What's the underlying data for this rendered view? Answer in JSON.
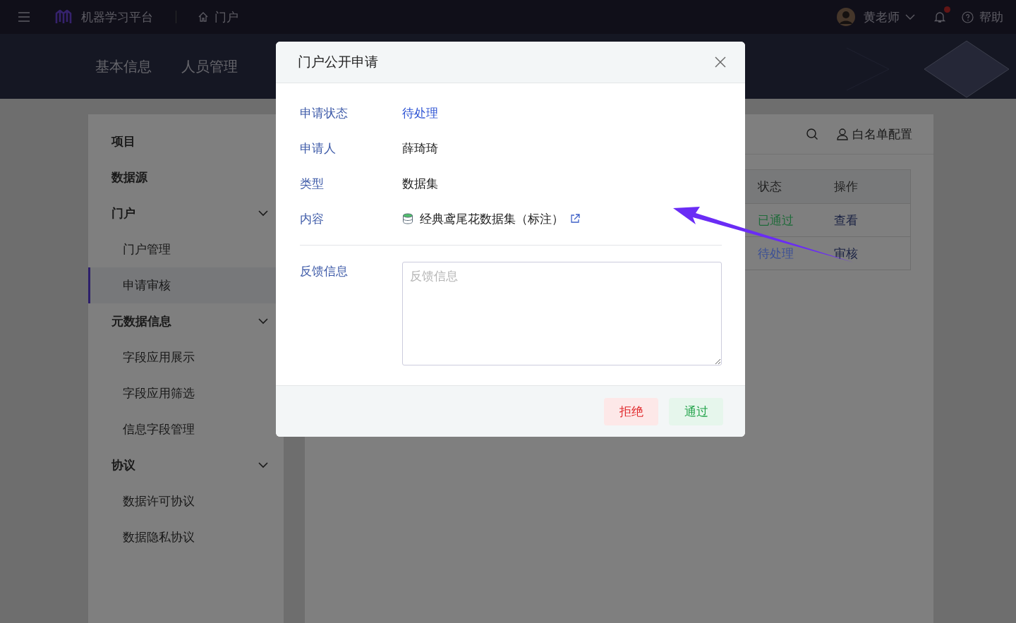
{
  "topbar": {
    "app_name": "机器学习平台",
    "breadcrumb": "门户",
    "user": "黄老师",
    "notification_dot": true,
    "help": "帮助"
  },
  "banner_tabs": [
    {
      "label": "基本信息",
      "selected": false
    },
    {
      "label": "人员管理",
      "selected": false
    }
  ],
  "sidebar": [
    {
      "label": "项目",
      "selected": false
    },
    {
      "label": "数据源",
      "selected": false
    },
    {
      "label": "门户",
      "expanded": true,
      "children": [
        {
          "label": "门户管理",
          "selected": false
        },
        {
          "label": "申请审核",
          "selected": true
        }
      ]
    },
    {
      "label": "元数据信息",
      "expanded": true,
      "children": [
        {
          "label": "字段应用展示",
          "selected": false
        },
        {
          "label": "字段应用筛选",
          "selected": false
        },
        {
          "label": "信息字段管理",
          "selected": false
        }
      ]
    },
    {
      "label": "协议",
      "expanded": true,
      "children": [
        {
          "label": "数据许可协议",
          "selected": false
        },
        {
          "label": "数据隐私协议",
          "selected": false
        }
      ]
    }
  ],
  "toolbar": {
    "whitelist": "白名单配置"
  },
  "table": {
    "columns": [
      "状态",
      "操作"
    ],
    "rows": [
      {
        "status": "已通过",
        "color": "#1f6b3a",
        "action": "查看"
      },
      {
        "status": "待处理",
        "color": "#3d5196",
        "action": "审核"
      }
    ]
  },
  "dialog": {
    "title": "门户公开申请",
    "fields": [
      {
        "kind": "status",
        "label": "申请状态",
        "value": "待处理"
      },
      {
        "kind": "text",
        "label": "申请人",
        "value": "薛琦琦"
      },
      {
        "kind": "text",
        "label": "类型",
        "value": "数据集"
      },
      {
        "kind": "link",
        "label": "内容",
        "value": "经典鸢尾花数据集（标注）"
      }
    ],
    "feedback": {
      "label": "反馈信息",
      "placeholder": "反馈信息"
    },
    "buttons": [
      {
        "kind": "reject",
        "label": "拒绝"
      },
      {
        "kind": "approve",
        "label": "通过"
      }
    ]
  }
}
